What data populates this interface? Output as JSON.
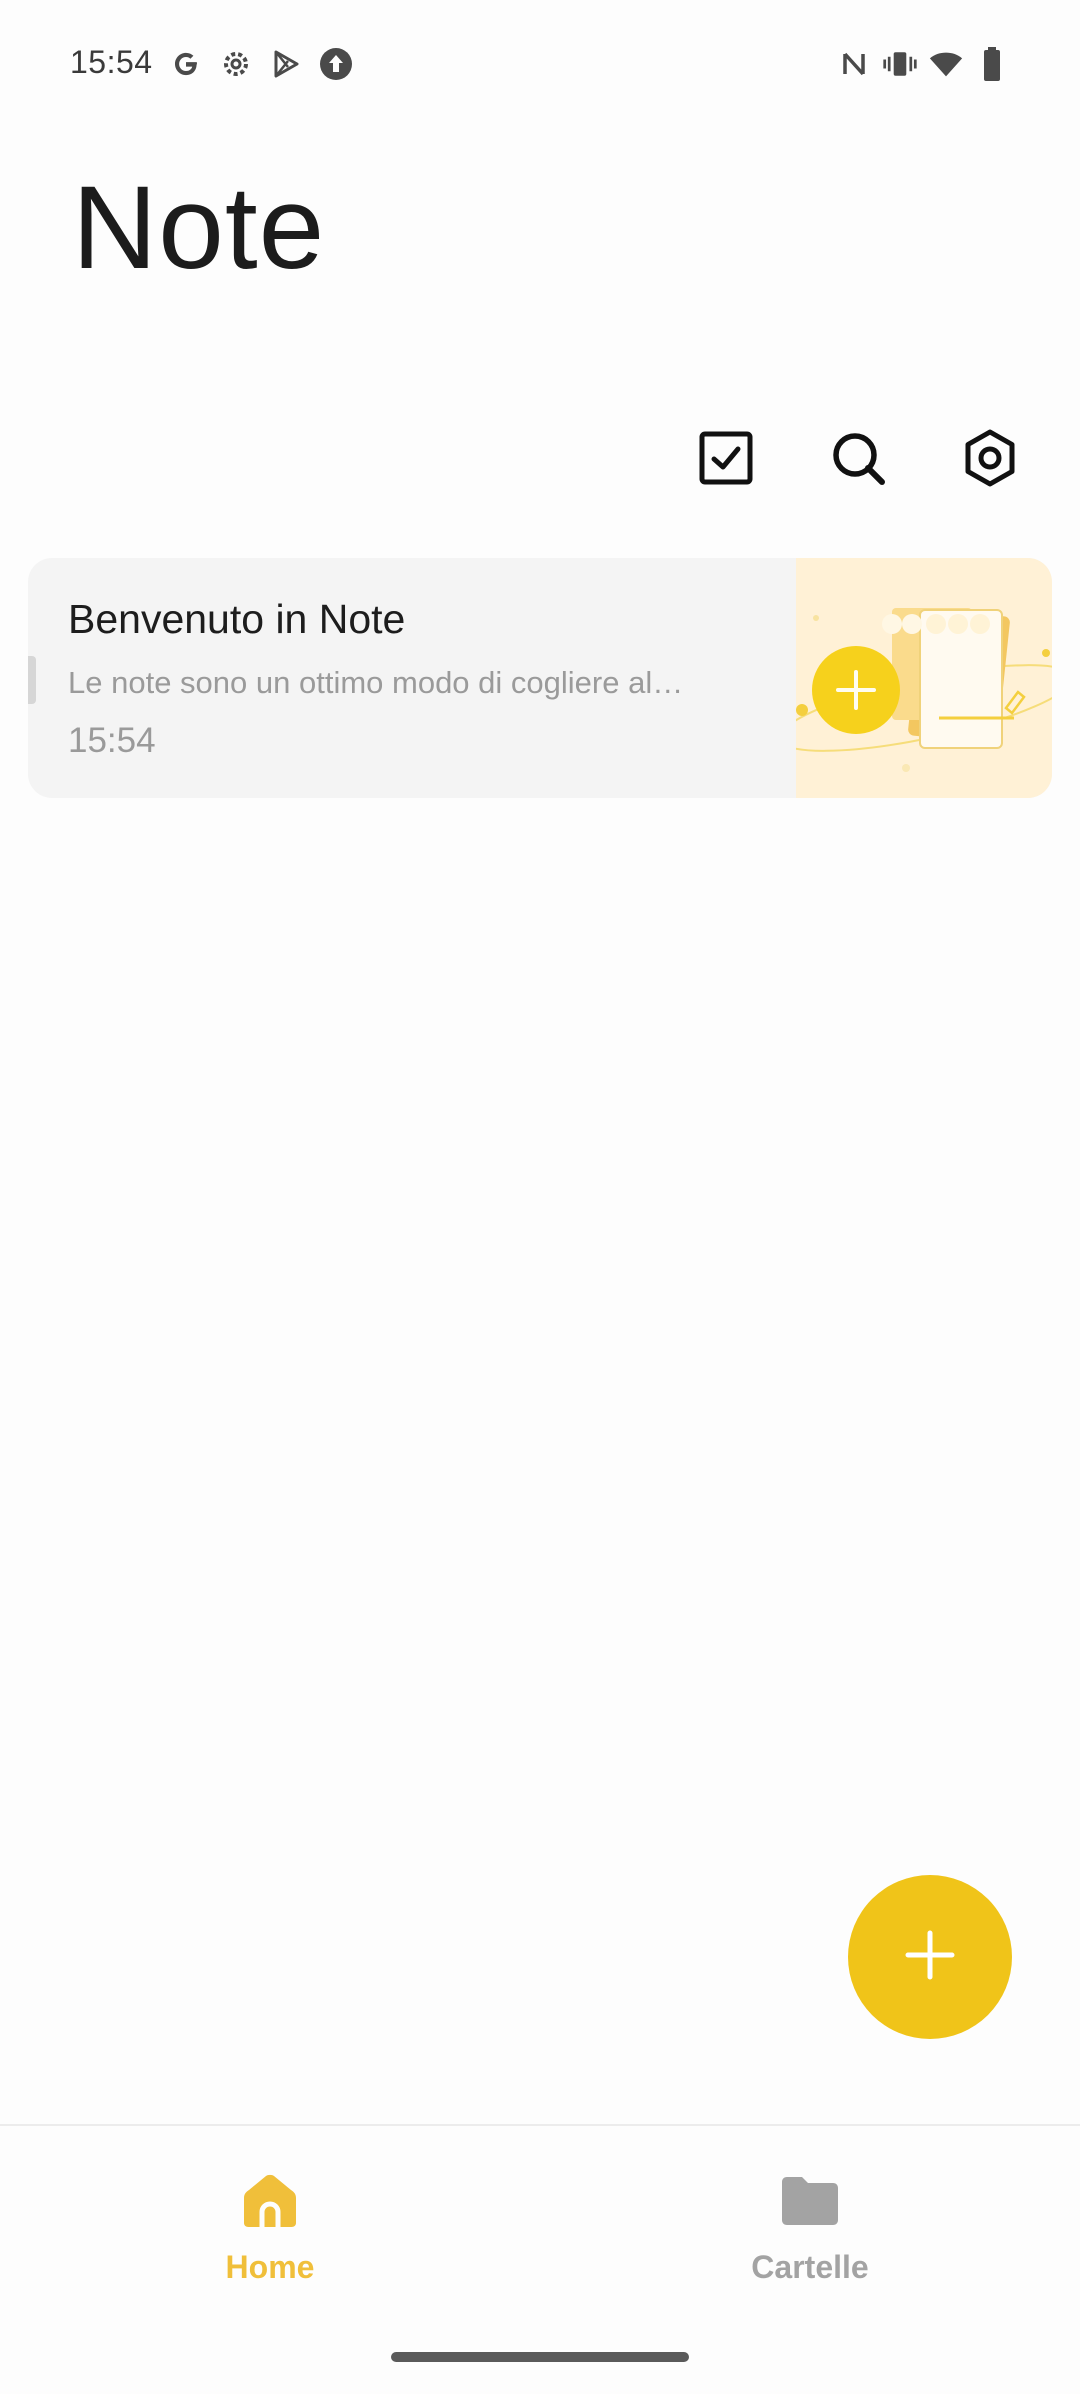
{
  "status_bar": {
    "time": "15:54",
    "left_icons": [
      "google-icon",
      "settings-gear-icon",
      "play-store-icon",
      "upload-icon"
    ],
    "right_icons": [
      "nfc-icon",
      "vibrate-icon",
      "wifi-icon",
      "battery-icon"
    ]
  },
  "header": {
    "title": "Note"
  },
  "toolbar": {
    "icons": [
      "checkbox-icon",
      "search-icon",
      "settings-icon"
    ]
  },
  "notes": [
    {
      "title": "Benvenuto in Note",
      "preview": "Le note sono un ottimo modo di cogliere al…",
      "time": "15:54"
    }
  ],
  "fab": {
    "icon": "plus-icon"
  },
  "bottom_nav": {
    "items": [
      {
        "label": "Home",
        "icon": "home-icon",
        "active": true
      },
      {
        "label": "Cartelle",
        "icon": "folder-icon",
        "active": false
      }
    ]
  },
  "colors": {
    "accent": "#f0c419",
    "nav_active": "#f0bf3a",
    "nav_inactive": "#a3a3a3",
    "card_background": "#f4f4f4",
    "thumbnail_background": "#fff1d6"
  }
}
